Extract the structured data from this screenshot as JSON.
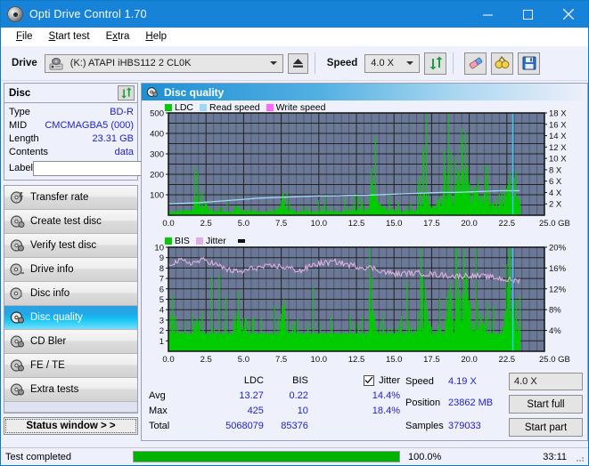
{
  "window": {
    "title": "Opti Drive Control 1.70",
    "icon": "disc-icon",
    "minimize": "minimize-icon",
    "maximize": "maximize-icon",
    "close": "close-icon"
  },
  "menu": {
    "items": [
      "File",
      "Start test",
      "Extra",
      "Help"
    ]
  },
  "toolbar": {
    "drive_label": "Drive",
    "drive_value": "(K:)   ATAPI iHBS112  2 CL0K",
    "eject_icon": "eject-icon",
    "speed_label": "Speed",
    "speed_value": "4.0 X",
    "refresh_icon": "refresh-icon",
    "eraser_icon": "eraser-icon",
    "glasses_icon": "glasses-icon",
    "save_icon": "save-icon"
  },
  "disc": {
    "header": "Disc",
    "refresh_icon": "refresh-icon",
    "rows": [
      {
        "key": "Type",
        "value": "BD-R"
      },
      {
        "key": "MID",
        "value": "CMCMAGBA5 (000)"
      },
      {
        "key": "Length",
        "value": "23.31 GB"
      },
      {
        "key": "Contents",
        "value": "data"
      }
    ],
    "label_key": "Label",
    "label_value": "",
    "label_placeholder": "",
    "cd_icon": "cd-icon"
  },
  "nav": {
    "items": [
      {
        "label": "Transfer rate",
        "icon": "disc-transfer-icon",
        "active": false
      },
      {
        "label": "Create test disc",
        "icon": "disc-create-icon",
        "active": false
      },
      {
        "label": "Verify test disc",
        "icon": "disc-verify-icon",
        "active": false
      },
      {
        "label": "Drive info",
        "icon": "drive-info-icon",
        "active": false
      },
      {
        "label": "Disc info",
        "icon": "disc-info-icon",
        "active": false
      },
      {
        "label": "Disc quality",
        "icon": "disc-quality-icon",
        "active": true
      },
      {
        "label": "CD Bler",
        "icon": "cd-bler-icon",
        "active": false
      },
      {
        "label": "FE / TE",
        "icon": "fe-te-icon",
        "active": false
      },
      {
        "label": "Extra tests",
        "icon": "extra-tests-icon",
        "active": false
      }
    ],
    "status_window": "Status window > >"
  },
  "panel": {
    "title": "Disc quality",
    "icon": "disc-quality-icon"
  },
  "stats": {
    "col_ldc": "LDC",
    "col_bis": "BIS",
    "jitter_label": "Jitter",
    "jitter_checked": true,
    "rows": [
      {
        "label": "Avg",
        "ldc": "13.27",
        "bis": "0.22",
        "jitter": "14.4%"
      },
      {
        "label": "Max",
        "ldc": "425",
        "bis": "10",
        "jitter": "18.4%"
      },
      {
        "label": "Total",
        "ldc": "5068079",
        "bis": "85376",
        "jitter": ""
      }
    ],
    "speed_key": "Speed",
    "speed_value": "4.19 X",
    "speed_select": "4.0 X",
    "position_key": "Position",
    "position_value": "23862 MB",
    "samples_key": "Samples",
    "samples_value": "379033",
    "start_full": "Start full",
    "start_part": "Start part"
  },
  "statusbar": {
    "text": "Test completed",
    "percent_label": "100.0%",
    "percent": 100,
    "time": "33:11"
  },
  "colors": {
    "accent": "#1683d8",
    "ldc_green": "#00cc00",
    "read_speed": "#9fd8f5",
    "write_speed": "#ff66ff",
    "jitter_pink": "#e0aee0",
    "plot_bg": "#6b7896",
    "value_blue": "#2222cc",
    "progress_green": "#00b200"
  },
  "chart_data": [
    {
      "type": "bar",
      "name": "LDC / Read speed chart",
      "title": "",
      "xlabel": "GB",
      "ylabel": "LDC",
      "xlim": [
        0,
        25
      ],
      "xticks": [
        "0.0",
        "2.5",
        "5.0",
        "7.5",
        "10.0",
        "12.5",
        "15.0",
        "17.5",
        "20.0",
        "22.5",
        "25.0 GB"
      ],
      "ylim": [
        0,
        500
      ],
      "yticks": [
        "100",
        "200",
        "300",
        "400",
        "500"
      ],
      "y2lim": [
        0,
        18
      ],
      "y2ticks": [
        "2 X",
        "4 X",
        "6 X",
        "8 X",
        "10 X",
        "12 X",
        "14 X",
        "16 X",
        "18 X"
      ],
      "legend": [
        {
          "name": "LDC",
          "color": "#00cc00"
        },
        {
          "name": "Read speed",
          "color": "#9fd8f5"
        },
        {
          "name": "Write speed",
          "color": "#ff66ff"
        }
      ],
      "legend_position": "top-left",
      "grid": true,
      "series": [
        {
          "name": "LDC",
          "type": "bar",
          "color": "#00cc00",
          "x": [
            0.0,
            0.3,
            0.6,
            0.9,
            1.2,
            1.5,
            1.8,
            2.1,
            2.4,
            2.7,
            3.0,
            3.3,
            3.6,
            3.9,
            4.2,
            4.5,
            4.8,
            5.1,
            5.4,
            5.7,
            6.0,
            6.3,
            6.6,
            6.9,
            7.2,
            7.5,
            7.8,
            8.1,
            8.4,
            8.7,
            9.0,
            9.3,
            9.6,
            9.9,
            10.2,
            10.5,
            10.8,
            11.1,
            11.4,
            11.7,
            12.0,
            12.3,
            12.6,
            12.9,
            13.2,
            13.5,
            13.8,
            14.1,
            14.4,
            14.7,
            15.0,
            15.3,
            15.6,
            15.9,
            16.2,
            16.5,
            16.8,
            17.1,
            17.4,
            17.7,
            18.0,
            18.3,
            18.6,
            18.9,
            19.2,
            19.5,
            19.8,
            20.1,
            20.4,
            20.7,
            21.0,
            21.3,
            21.6,
            21.9,
            22.2,
            22.5,
            22.8,
            23.1,
            23.3
          ],
          "values": [
            20,
            22,
            18,
            35,
            30,
            25,
            110,
            60,
            95,
            28,
            22,
            26,
            20,
            24,
            18,
            70,
            40,
            26,
            30,
            22,
            24,
            20,
            26,
            22,
            30,
            150,
            60,
            35,
            28,
            22,
            30,
            26,
            24,
            20,
            22,
            28,
            26,
            30,
            24,
            22,
            35,
            40,
            30,
            26,
            28,
            190,
            120,
            60,
            40,
            36,
            30,
            34,
            28,
            32,
            36,
            40,
            70,
            160,
            60,
            45,
            120,
            90,
            310,
            70,
            260,
            230,
            300,
            120,
            200,
            110,
            140,
            60,
            80,
            55,
            90,
            250,
            150,
            120,
            100
          ]
        },
        {
          "name": "Read speed",
          "type": "line",
          "color": "#9fd8f5",
          "axis": "y2",
          "x": [
            0.0,
            1.0,
            2.0,
            3.0,
            4.0,
            5.0,
            6.0,
            7.0,
            8.0,
            9.0,
            10.0,
            11.0,
            12.0,
            13.0,
            14.0,
            15.0,
            16.0,
            17.0,
            18.0,
            19.0,
            20.0,
            21.0,
            22.0,
            22.8,
            23.3
          ],
          "values": [
            2.0,
            2.1,
            2.2,
            2.4,
            2.6,
            2.8,
            3.0,
            3.1,
            3.2,
            3.3,
            3.4,
            3.4,
            3.5,
            3.5,
            3.6,
            3.7,
            3.8,
            3.9,
            4.0,
            4.0,
            4.1,
            4.2,
            4.3,
            4.3,
            4.3
          ]
        },
        {
          "name": "Write speed",
          "type": "line",
          "color": "#ff66ff",
          "axis": "y2",
          "x": [],
          "values": []
        }
      ],
      "markers": [
        {
          "type": "vline",
          "x": 22.9,
          "color": "#33ccff"
        }
      ]
    },
    {
      "type": "bar",
      "name": "BIS / Jitter chart",
      "title": "",
      "xlabel": "GB",
      "ylabel": "BIS",
      "xlim": [
        0,
        25
      ],
      "xticks": [
        "0.0",
        "2.5",
        "5.0",
        "7.5",
        "10.0",
        "12.5",
        "15.0",
        "17.5",
        "20.0",
        "22.5",
        "25.0 GB"
      ],
      "ylim": [
        0,
        10
      ],
      "yticks": [
        "1",
        "2",
        "3",
        "4",
        "5",
        "6",
        "7",
        "8",
        "9",
        "10"
      ],
      "y2lim": [
        0,
        20
      ],
      "y2ticks": [
        "4%",
        "8%",
        "12%",
        "16%",
        "20%"
      ],
      "legend": [
        {
          "name": "BIS",
          "color": "#00cc00"
        },
        {
          "name": "Jitter",
          "color": "#e0aee0"
        }
      ],
      "legend_position": "top-left",
      "grid": true,
      "series": [
        {
          "name": "BIS",
          "type": "bar",
          "color": "#00cc00",
          "x": [
            0.0,
            0.3,
            0.6,
            0.9,
            1.2,
            1.5,
            1.8,
            2.1,
            2.4,
            2.7,
            3.0,
            3.3,
            3.6,
            3.9,
            4.2,
            4.5,
            4.8,
            5.1,
            5.4,
            5.7,
            6.0,
            6.3,
            6.6,
            6.9,
            7.2,
            7.5,
            7.8,
            8.1,
            8.4,
            8.7,
            9.0,
            9.3,
            9.6,
            9.9,
            10.2,
            10.5,
            10.8,
            11.1,
            11.4,
            11.7,
            12.0,
            12.3,
            12.6,
            12.9,
            13.2,
            13.5,
            13.8,
            14.1,
            14.4,
            14.7,
            15.0,
            15.3,
            15.6,
            15.9,
            16.2,
            16.5,
            16.8,
            17.1,
            17.4,
            17.7,
            18.0,
            18.3,
            18.6,
            18.9,
            19.2,
            19.5,
            19.8,
            20.1,
            20.4,
            20.7,
            21.0,
            21.3,
            21.6,
            21.9,
            22.2,
            22.5,
            22.8,
            23.1,
            23.3
          ],
          "values": [
            2,
            2,
            2,
            3,
            2,
            2,
            4,
            3,
            2,
            2,
            2,
            2,
            2,
            2,
            2,
            5,
            3,
            2,
            2,
            2,
            2,
            2,
            2,
            2,
            2,
            6,
            3,
            2,
            2,
            2,
            2,
            2,
            2,
            2,
            2,
            2,
            2,
            2,
            2,
            2,
            2,
            2,
            2,
            2,
            2,
            5,
            4,
            2,
            2,
            2,
            2,
            2,
            2,
            2,
            2,
            3,
            4,
            6,
            3,
            2,
            3,
            2,
            10,
            3,
            8,
            7,
            9,
            3,
            4,
            3,
            4,
            2,
            3,
            2,
            3,
            7,
            5,
            3,
            3
          ]
        },
        {
          "name": "Jitter",
          "type": "line",
          "color": "#e0aee0",
          "axis": "y2",
          "x": [
            0.0,
            0.8,
            1.6,
            2.4,
            3.2,
            4.0,
            4.8,
            5.6,
            6.4,
            7.2,
            8.0,
            8.8,
            9.6,
            10.4,
            11.2,
            12.0,
            12.8,
            13.6,
            14.4,
            15.2,
            16.0,
            16.8,
            17.6,
            18.4,
            19.2,
            20.0,
            20.8,
            21.6,
            22.4,
            22.9
          ],
          "values": [
            16.8,
            17.4,
            17.0,
            17.6,
            16.6,
            15.6,
            15.2,
            16.0,
            16.2,
            16.4,
            16.0,
            15.4,
            16.6,
            17.0,
            17.2,
            16.6,
            16.2,
            16.0,
            15.2,
            14.8,
            15.0,
            15.0,
            14.8,
            14.6,
            14.4,
            14.6,
            14.4,
            14.2,
            13.8,
            13.6
          ]
        }
      ],
      "markers": [
        {
          "type": "vline",
          "x": 22.9,
          "color": "#33ccff"
        }
      ]
    }
  ]
}
